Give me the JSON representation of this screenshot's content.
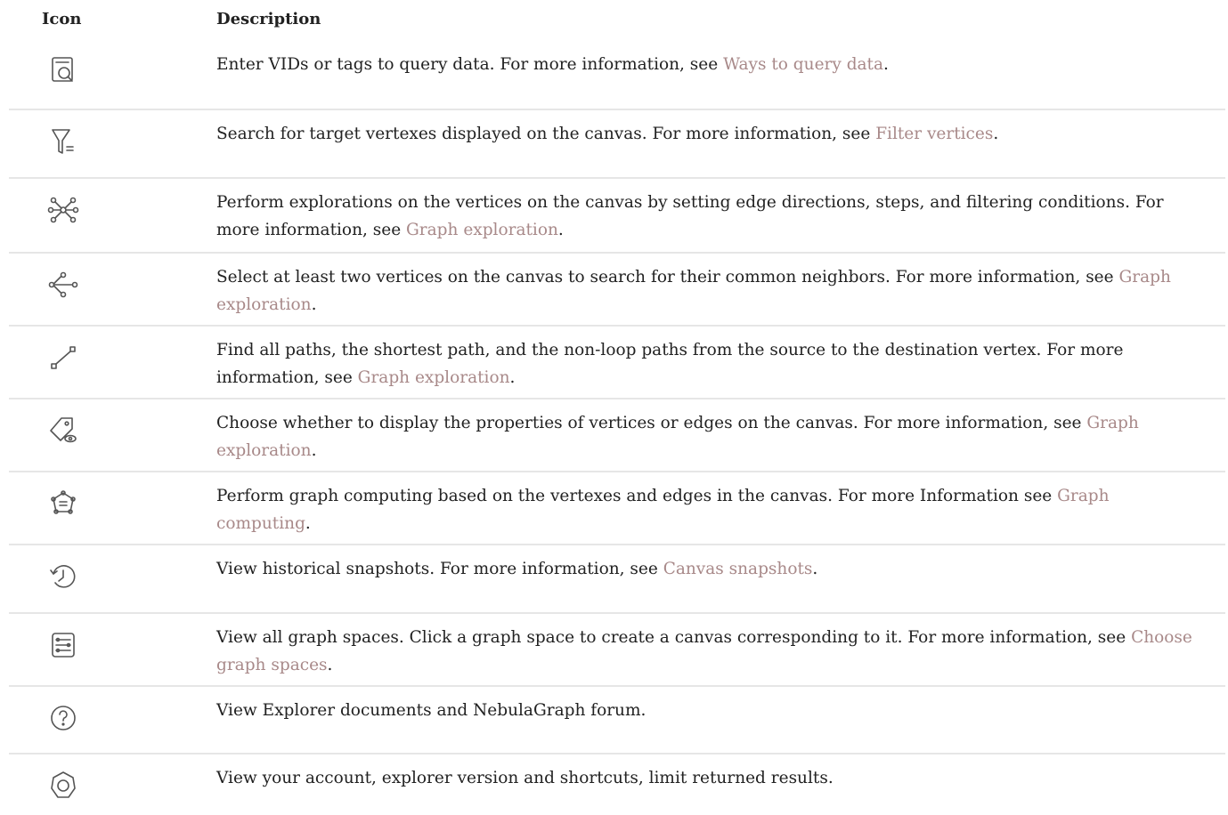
{
  "header": {
    "icon_label": "Icon",
    "description_label": "Description"
  },
  "rows": [
    {
      "icon": "query-search-icon",
      "text": "Enter VIDs or tags to query data. For more information, see ",
      "link": "Ways to query data",
      "after": "."
    },
    {
      "icon": "filter-icon",
      "text": "Search for target vertexes displayed on the canvas. For more information, see ",
      "link": "Filter vertices",
      "after": "."
    },
    {
      "icon": "graph-exploration-icon",
      "text": "Perform explorations on the vertices on the canvas by setting edge directions, steps, and filtering conditions. For more information, see ",
      "link": "Graph exploration",
      "after": "."
    },
    {
      "icon": "common-neighbors-icon",
      "text": "Select at least two vertices on the canvas to search for their common neighbors. For more information, see ",
      "link": "Graph exploration",
      "after": "."
    },
    {
      "icon": "find-path-icon",
      "text": "Find all paths, the shortest path, and the non-loop paths from the source to the destination vertex. For more information, see ",
      "link": "Graph exploration",
      "after": "."
    },
    {
      "icon": "property-view-icon",
      "text": "Choose whether to display the properties of vertices or edges on the canvas. For more information, see ",
      "link": "Graph exploration",
      "after": "."
    },
    {
      "icon": "graph-computing-icon",
      "text": "Perform graph computing based on the vertexes and edges in the canvas. For more Information see ",
      "link": "Graph computing",
      "after": "."
    },
    {
      "icon": "history-icon",
      "text": "View historical snapshots. For more information, see ",
      "link": "Canvas snapshots",
      "after": "."
    },
    {
      "icon": "graph-spaces-icon",
      "text": "View all graph spaces. Click a graph space to create a canvas corresponding to it. For more information, see ",
      "link": "Choose graph spaces",
      "after": "."
    },
    {
      "icon": "help-icon",
      "text": "View Explorer documents and NebulaGraph forum.",
      "link": "",
      "after": ""
    },
    {
      "icon": "settings-icon",
      "text": "View your account, explorer version and shortcuts, limit returned results.",
      "link": "",
      "after": ""
    }
  ]
}
